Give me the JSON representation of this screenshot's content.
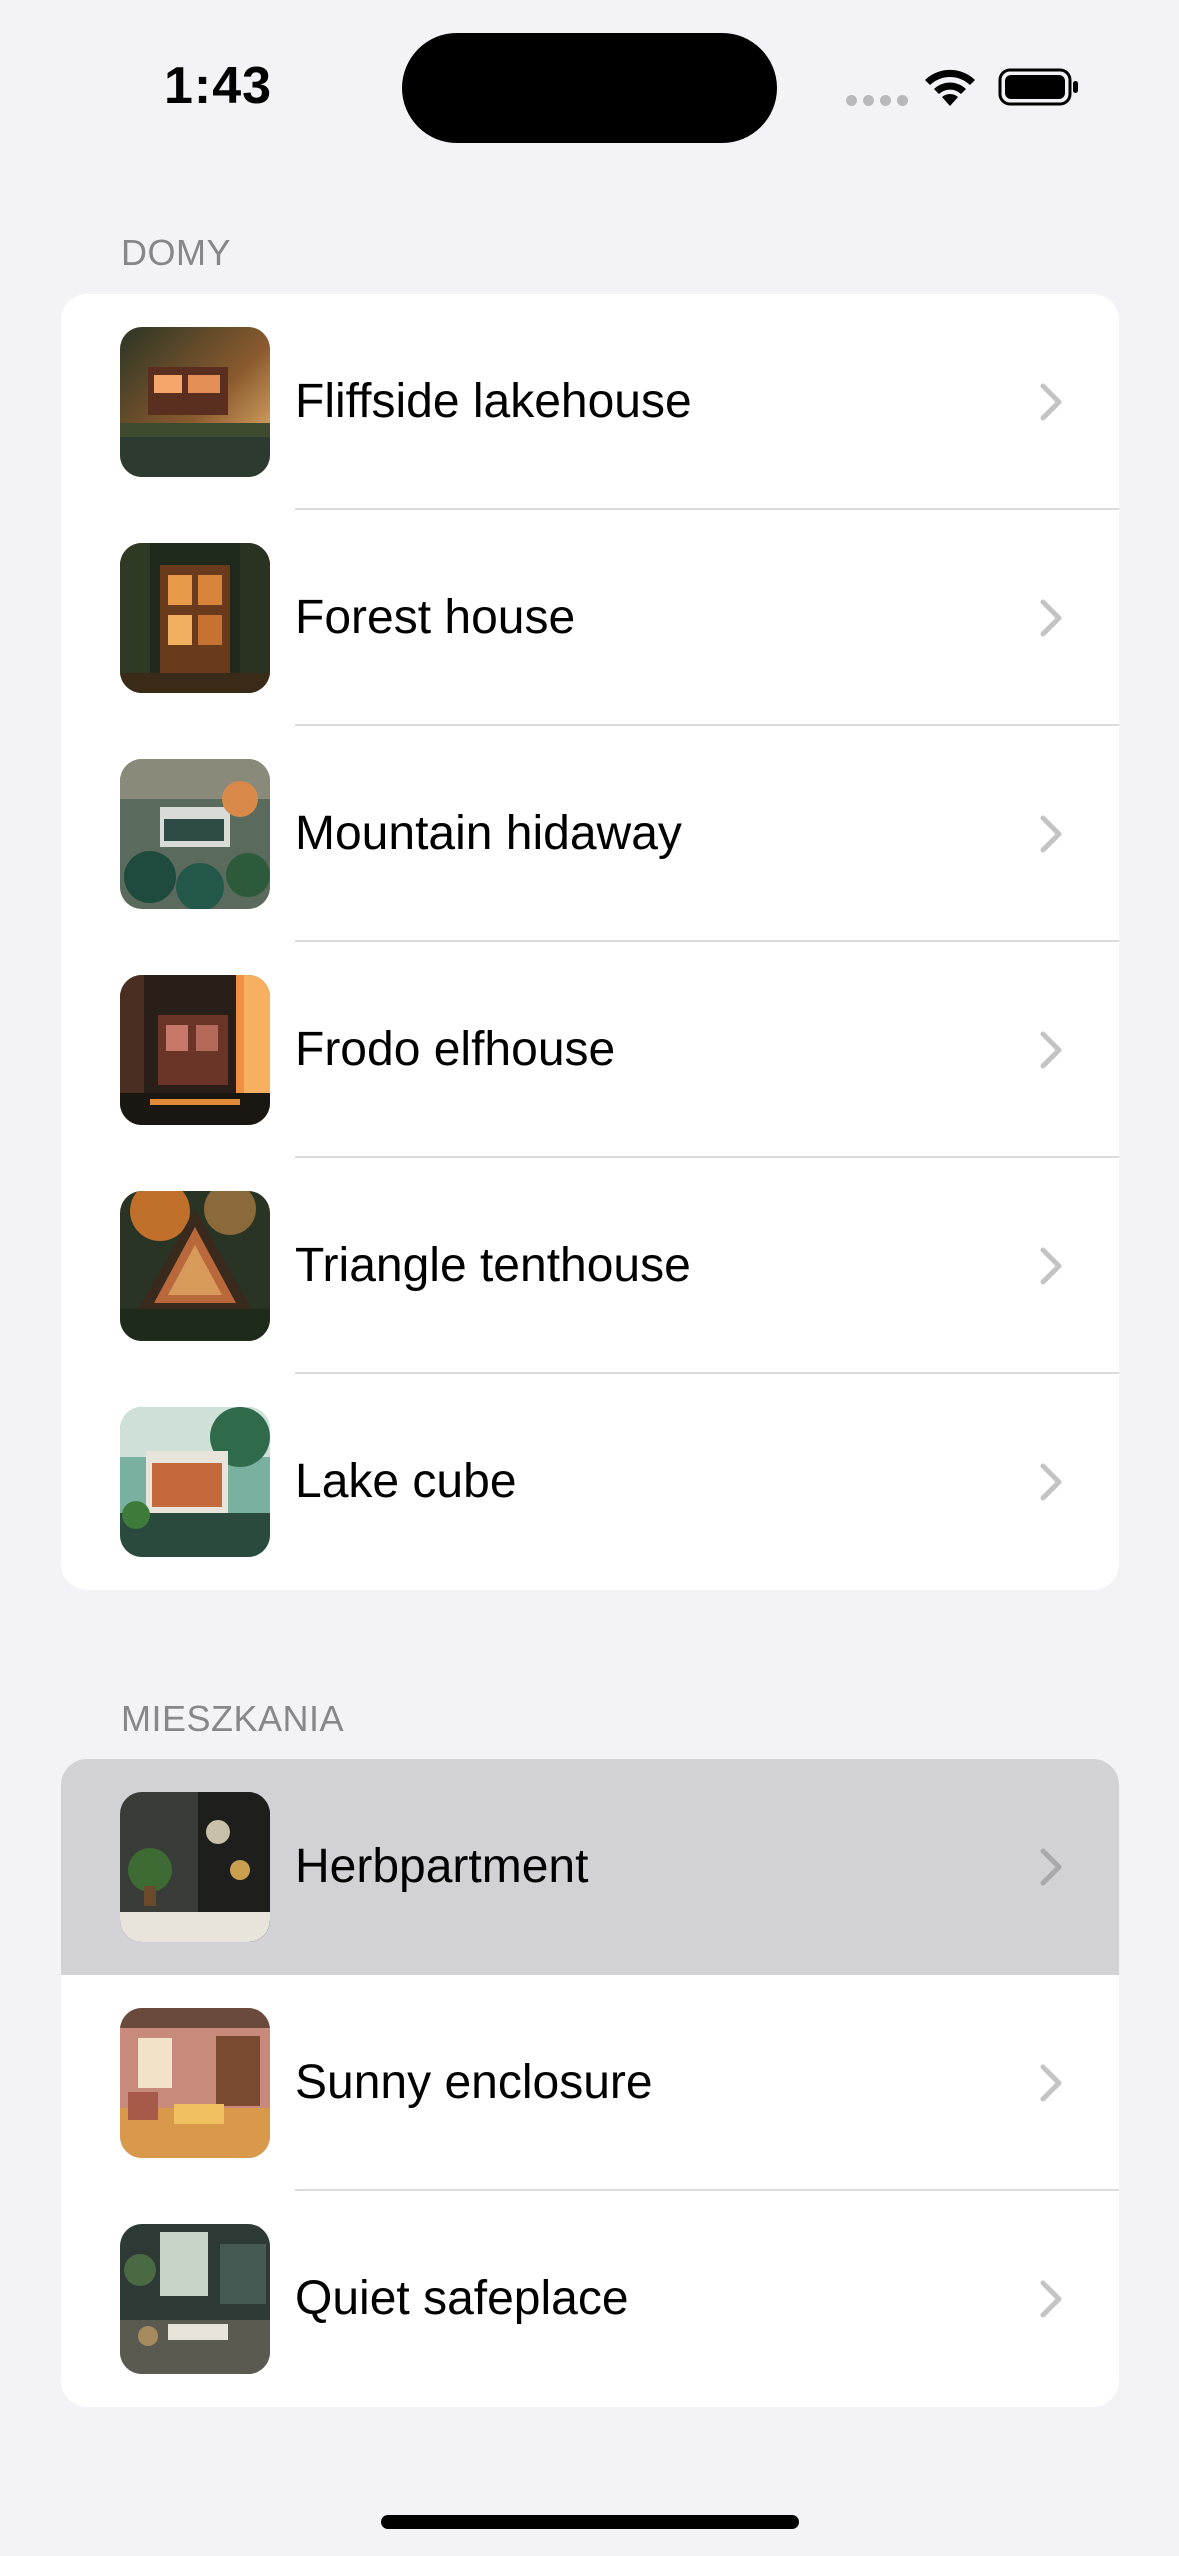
{
  "status_bar": {
    "time": "1:43"
  },
  "sections": [
    {
      "header": "DOMY",
      "items": [
        {
          "label": "Fliffside lakehouse",
          "icon": "lakehouse-thumbnail"
        },
        {
          "label": "Forest house",
          "icon": "forest-house-thumbnail"
        },
        {
          "label": "Mountain hidaway",
          "icon": "mountain-hideaway-thumbnail"
        },
        {
          "label": "Frodo elfhouse",
          "icon": "elfhouse-thumbnail"
        },
        {
          "label": "Triangle tenthouse",
          "icon": "tenthouse-thumbnail"
        },
        {
          "label": "Lake cube",
          "icon": "lake-cube-thumbnail"
        }
      ]
    },
    {
      "header": "MIESZKANIA",
      "items": [
        {
          "label": "Herbpartment",
          "icon": "herbpartment-thumbnail",
          "selected": true
        },
        {
          "label": "Sunny enclosure",
          "icon": "sunny-enclosure-thumbnail"
        },
        {
          "label": "Quiet safeplace",
          "icon": "quiet-safeplace-thumbnail"
        }
      ]
    }
  ],
  "colors": {
    "background": "#f2f2f7",
    "card": "#ffffff",
    "selected_row": "#d1d1d6",
    "section_header": "#86868b",
    "chevron": "#c4c4c7"
  }
}
